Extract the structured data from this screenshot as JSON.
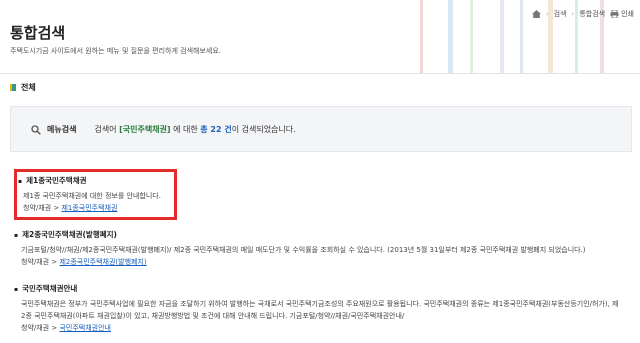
{
  "header": {
    "title": "통합검색",
    "subtitle": "주택도시기금 사이트에서 원하는 메뉴 및 질문을 편리하게 검색해보세요.",
    "breadcrumb": [
      "검색",
      "통합검색"
    ],
    "print_label": "인쇄"
  },
  "section": {
    "title": "전체"
  },
  "summary": {
    "menu_label": "메뉴검색",
    "prefix": "검색어 ",
    "keyword": "[국민주택채권]",
    "middle": " 에 대한 ",
    "count": "총 22 건",
    "suffix": "이 검색되었습니다."
  },
  "results": [
    {
      "title": "제1종국민주택채권",
      "desc": "제1종 국민주택채권에 대한 정보를 안내합니다.",
      "path_prefix": "청약/채권 > ",
      "path_link": "제1종국민주택채권"
    },
    {
      "title": "제2종국민주택채권(발행폐지)",
      "desc": "기금포털/청약//채권/제2종국민주택채권(발행폐지)/ 제2종 국민주택채권의 매일 매도단가 및 수익률을 조회하실 수 있습니다. (2013년 5월 31일부터 제2종 국민주택채권 발행폐지 되었습니다.)",
      "path_prefix": "청약/채권 > ",
      "path_link": "제2종국민주택채권(발행폐지)"
    },
    {
      "title": "국민주택채권안내",
      "desc": "국민주택채권은 정부가 국민주택사업에 필요한 자금을 조달하기 위하여 발행하는 국채로서 국민주택기금조성의 주요재원으로 활용됩니다. 국민주택채권의 종류는 제1종국민주택채권(부동산등기인/허가), 제2종 국민주택채권(아파트 채권입찰)이 있고, 채권방행방법 및 조건에 대해 안내해 드립니다. 기금포털/청약//채권/국민주택채권안내/",
      "path_prefix": "청약/채권 > ",
      "path_link": "국민주택채권안내"
    }
  ]
}
